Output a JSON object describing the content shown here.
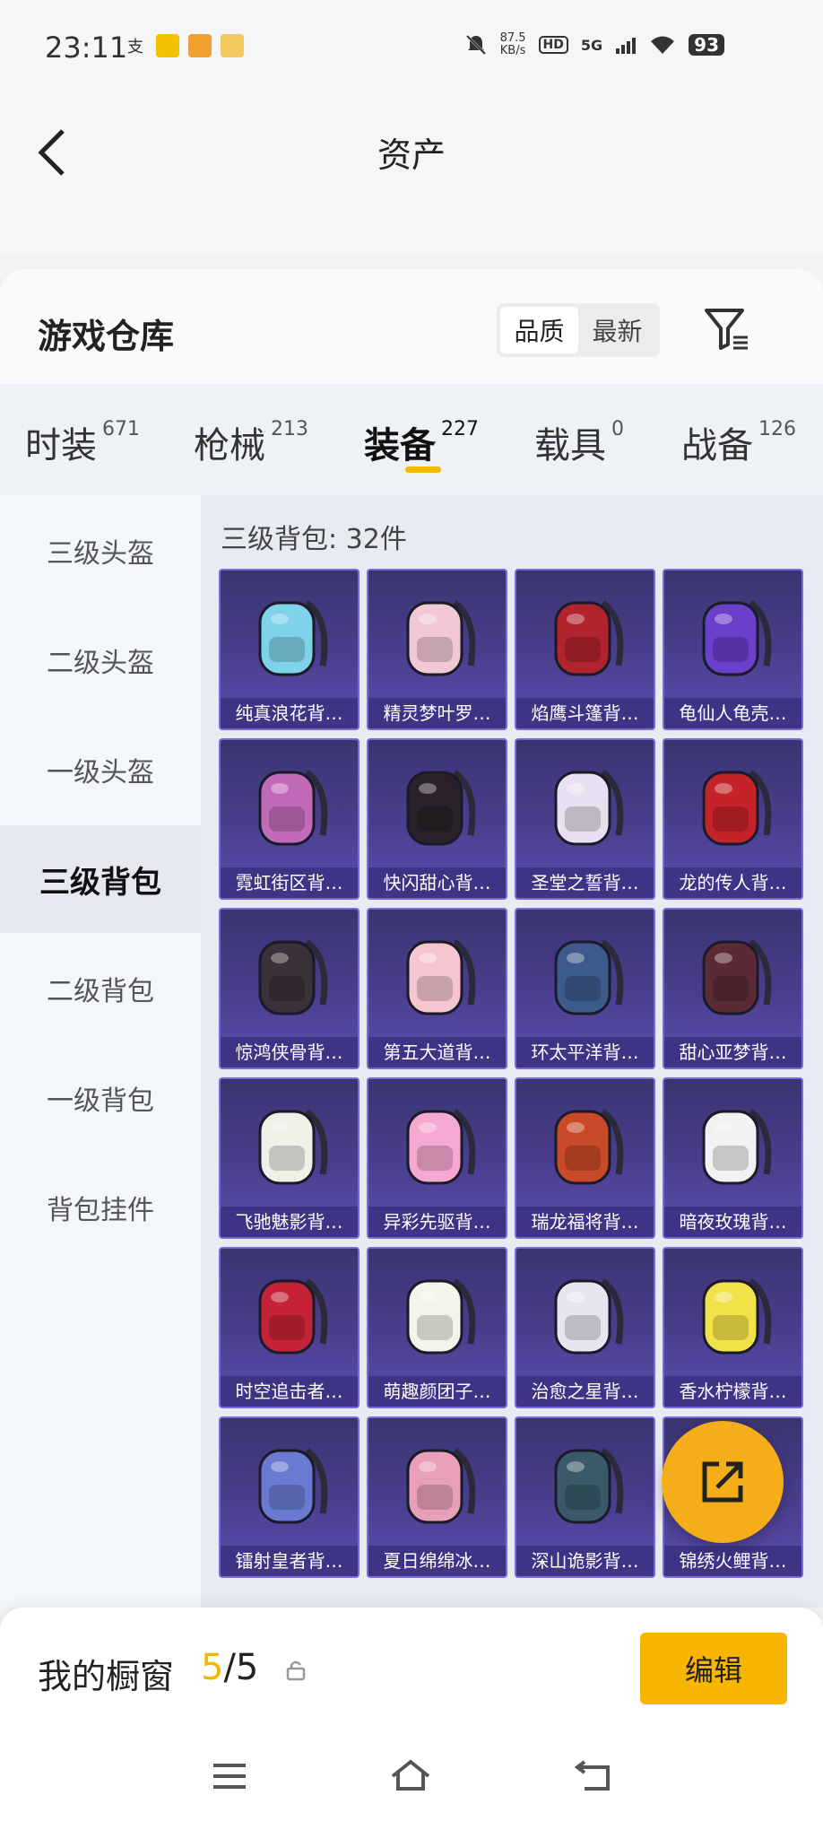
{
  "status_bar": {
    "time": "23:11",
    "net_speed_value": "87.5",
    "net_speed_unit": "KB/s",
    "hd": "HD",
    "network": "5G",
    "battery": "93"
  },
  "header": {
    "title": "资产"
  },
  "warehouse": {
    "title": "游戏仓库",
    "sort_options": [
      "品质",
      "最新"
    ],
    "active_sort": "品质"
  },
  "tabs": [
    {
      "label": "时装",
      "count": "671"
    },
    {
      "label": "枪械",
      "count": "213"
    },
    {
      "label": "装备",
      "count": "227"
    },
    {
      "label": "载具",
      "count": "0"
    },
    {
      "label": "战备",
      "count": "126"
    }
  ],
  "active_tab": "装备",
  "sidebar": {
    "items": [
      "三级头盔",
      "二级头盔",
      "一级头盔",
      "三级背包",
      "二级背包",
      "一级背包",
      "背包挂件"
    ],
    "active": "三级背包"
  },
  "grid": {
    "count_label": "三级背包: 32件",
    "items": [
      {
        "name": "纯真浪花背…",
        "color": "#7fd3e8"
      },
      {
        "name": "精灵梦叶罗…",
        "color": "#f2c8d4"
      },
      {
        "name": "焰鹰斗篷背…",
        "color": "#b0242e"
      },
      {
        "name": "龟仙人龟壳…",
        "color": "#6a3fc9"
      },
      {
        "name": "霓虹街区背…",
        "color": "#c06ab8"
      },
      {
        "name": "快闪甜心背…",
        "color": "#2a2228"
      },
      {
        "name": "圣堂之誓背…",
        "color": "#e8e0f0"
      },
      {
        "name": "龙的传人背…",
        "color": "#c4232a"
      },
      {
        "name": "惊鸿侠骨背…",
        "color": "#3a3038"
      },
      {
        "name": "第五大道背…",
        "color": "#f5c6cf"
      },
      {
        "name": "环太平洋背…",
        "color": "#3d5a8c"
      },
      {
        "name": "甜心亚梦背…",
        "color": "#5a2a35"
      },
      {
        "name": "飞驰魅影背…",
        "color": "#f0f0e8"
      },
      {
        "name": "异彩先驱背…",
        "color": "#f5a8d0"
      },
      {
        "name": "瑞龙福将背…",
        "color": "#c84a28"
      },
      {
        "name": "暗夜玫瑰背…",
        "color": "#f2f2f2"
      },
      {
        "name": "时空追击者…",
        "color": "#c42236"
      },
      {
        "name": "萌趣颜团子…",
        "color": "#f4f4ea"
      },
      {
        "name": "治愈之星背…",
        "color": "#e6e6f2"
      },
      {
        "name": "香水柠檬背…",
        "color": "#f2e24a"
      },
      {
        "name": "镭射皇者背…",
        "color": "#6a7ad0"
      },
      {
        "name": "夏日绵绵冰…",
        "color": "#e8a0b8"
      },
      {
        "name": "深山诡影背…",
        "color": "#3a5a6a"
      },
      {
        "name": "锦绣火鲤背…",
        "color": "#e87a2a"
      }
    ]
  },
  "bottom": {
    "showcase_label": "我的橱窗",
    "showcase_current": "5",
    "showcase_total": "/5",
    "edit_label": "编辑"
  },
  "colors": {
    "accent": "#f5b800",
    "card_bg": "#4a3f8f",
    "card_border": "#7a6ad8"
  },
  "icons": [
    "back-arrow-icon",
    "filter-icon",
    "share-icon",
    "lock-icon",
    "menu-icon",
    "home-icon",
    "return-icon"
  ]
}
